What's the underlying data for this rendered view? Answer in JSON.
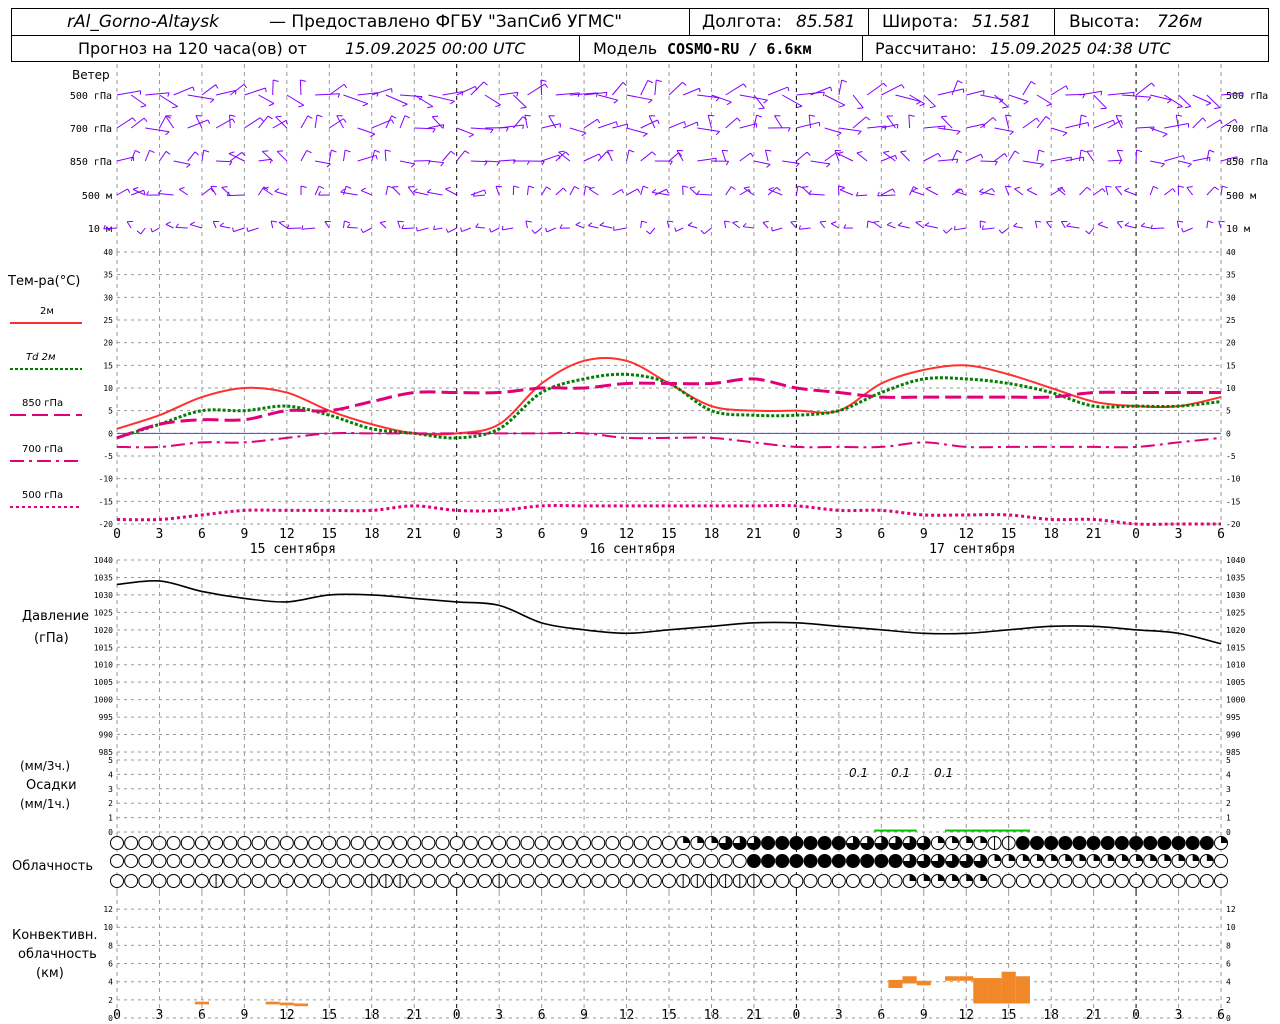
{
  "header": {
    "station": "rAl_Gorno-Altaysk",
    "provider": "— Предоставлено ФГБУ \"ЗапСиб УГМС\"",
    "lon_label": "Долгота:",
    "lon_value": "85.581",
    "lat_label": "Широта:",
    "lat_value": "51.581",
    "alt_label": "Высота:",
    "alt_value": "726м",
    "forecast_label": "Прогноз на 120 часа(ов) от",
    "forecast_time": "15.09.2025 00:00 UTC",
    "model_label": "Модель",
    "model_name": "COSMO-RU / 6.6км",
    "calc_label": "Рассчитано:",
    "calc_time": "15.09.2025 04:38 UTC"
  },
  "panels": {
    "wind": {
      "title": "Ветер",
      "levels": [
        "500 гПа",
        "700 гПа",
        "850 гПа",
        "500 м",
        "10 м"
      ]
    },
    "temp": {
      "title": "Тем-ра(°C)",
      "legend": [
        "2м",
        "Td  2м",
        "850 гПа",
        "700 гПа",
        "500 гПа"
      ]
    },
    "pressure": {
      "title_line1": "Давление",
      "title_line2": "(гПа)"
    },
    "precip": {
      "line1": "(мм/3ч.)",
      "line2": "Осадки",
      "line3": "(мм/1ч.)",
      "values": [
        "0.1",
        "0.1",
        "0.1"
      ]
    },
    "cloud": {
      "title": "Облачность"
    },
    "conv": {
      "line1": "Конвективн.",
      "line2": "облачность",
      "line3": "(км)"
    }
  },
  "axis": {
    "hour_ticks": [
      "0",
      "3",
      "6",
      "9",
      "12",
      "15",
      "18",
      "21",
      "0",
      "3",
      "6",
      "9",
      "12",
      "15",
      "18",
      "21",
      "0",
      "3",
      "6",
      "9",
      "12",
      "15",
      "18",
      "21",
      "0",
      "3",
      "6"
    ],
    "days": [
      "15 сентября",
      "16 сентября",
      "17 сентября"
    ]
  },
  "colors": {
    "t2m": "#ff3030",
    "td2m": "#008000",
    "t850": "#e0007a",
    "t700": "#e0007a",
    "t500": "#e0007a",
    "wind": "#8000ff",
    "precip": "#00c000",
    "conv": "#f0882a",
    "grid": "#9a9a9a"
  },
  "chart_data": [
    {
      "type": "line",
      "panel": "temperature",
      "ylim": [
        -20,
        40
      ],
      "yticks": [
        "40",
        "35",
        "30",
        "25",
        "20",
        "15",
        "10",
        "5",
        "0",
        "-5",
        "-10",
        "-15",
        "-20"
      ],
      "x_hours": [
        0,
        3,
        6,
        9,
        12,
        15,
        18,
        21,
        24,
        27,
        30,
        33,
        36,
        39,
        42,
        45,
        48,
        51,
        54,
        57,
        60,
        63,
        66,
        69,
        72,
        75,
        78
      ],
      "series": [
        {
          "name": "2м",
          "values": [
            1,
            4,
            8,
            10,
            9,
            5,
            2,
            0,
            0,
            2,
            11,
            16,
            16,
            11,
            6,
            5,
            5,
            5,
            11,
            14,
            15,
            13,
            10,
            7,
            6,
            6,
            8
          ]
        },
        {
          "name": "Td  2м",
          "values": [
            -1,
            2,
            5,
            5,
            6,
            4,
            1,
            0,
            -1,
            1,
            9,
            12,
            13,
            11,
            5,
            4,
            4,
            5,
            9,
            12,
            12,
            11,
            9,
            6,
            6,
            6,
            7
          ]
        },
        {
          "name": "850 гПа",
          "values": [
            -1,
            2,
            3,
            3,
            5,
            5,
            7,
            9,
            9,
            9,
            10,
            10,
            11,
            11,
            11,
            12,
            10,
            9,
            8,
            8,
            8,
            8,
            8,
            9,
            9,
            9,
            9
          ]
        },
        {
          "name": "700 гПа",
          "values": [
            -3,
            -3,
            -2,
            -2,
            -1,
            0,
            0,
            0,
            0,
            0,
            0,
            0,
            -1,
            -1,
            -1,
            -2,
            -3,
            -3,
            -3,
            -2,
            -3,
            -3,
            -3,
            -3,
            -3,
            -2,
            -1
          ]
        },
        {
          "name": "500 гПа",
          "values": [
            -19,
            -19,
            -18,
            -17,
            -17,
            -17,
            -17,
            -16,
            -17,
            -17,
            -16,
            -16,
            -16,
            -16,
            -16,
            -16,
            -16,
            -17,
            -17,
            -18,
            -18,
            -18,
            -19,
            -19,
            -20,
            -20,
            -20
          ]
        }
      ]
    },
    {
      "type": "line",
      "panel": "pressure",
      "ylim": [
        985,
        1040
      ],
      "yticks": [
        "1040",
        "1035",
        "1030",
        "1025",
        "1020",
        "1015",
        "1010",
        "1005",
        "1000",
        "995",
        "990",
        "985"
      ],
      "x_hours": [
        0,
        3,
        6,
        9,
        12,
        15,
        18,
        21,
        24,
        27,
        30,
        33,
        36,
        39,
        42,
        45,
        48,
        51,
        54,
        57,
        60,
        63,
        66,
        69,
        72,
        75,
        78
      ],
      "series": [
        {
          "name": "Давление",
          "values": [
            1033,
            1034,
            1031,
            1029,
            1028,
            1030,
            1030,
            1029,
            1028,
            1027,
            1022,
            1020,
            1019,
            1020,
            1021,
            1022,
            1022,
            1021,
            1020,
            1019,
            1019,
            1020,
            1021,
            1021,
            1020,
            1019,
            1016
          ]
        }
      ]
    },
    {
      "type": "bar",
      "panel": "precipitation",
      "ylim": [
        0,
        5
      ],
      "yticks": [
        "5",
        "4",
        "3",
        "2",
        "1",
        "0"
      ],
      "x_hours": [
        55,
        60,
        63
      ],
      "values": [
        0.1,
        0.1,
        0.1
      ]
    },
    {
      "type": "bar",
      "panel": "convective_cloud",
      "ylim": [
        0,
        13
      ],
      "yticks": [
        "12",
        "10",
        "8",
        "6",
        "4",
        "2",
        "0"
      ],
      "bars": [
        {
          "hour": 6,
          "base_km": 1.5,
          "top_km": 1.8
        },
        {
          "hour": 11,
          "base_km": 1.5,
          "top_km": 1.8
        },
        {
          "hour": 12,
          "base_km": 1.4,
          "top_km": 1.7
        },
        {
          "hour": 13,
          "base_km": 1.3,
          "top_km": 1.6
        },
        {
          "hour": 55,
          "base_km": 3.3,
          "top_km": 4.2
        },
        {
          "hour": 56,
          "base_km": 3.8,
          "top_km": 4.6
        },
        {
          "hour": 57,
          "base_km": 3.6,
          "top_km": 4.1
        },
        {
          "hour": 59,
          "base_km": 4.1,
          "top_km": 4.6
        },
        {
          "hour": 60,
          "base_km": 4.1,
          "top_km": 4.6
        },
        {
          "hour": 61,
          "base_km": 1.6,
          "top_km": 4.4
        },
        {
          "hour": 62,
          "base_km": 1.6,
          "top_km": 4.4
        },
        {
          "hour": 63,
          "base_km": 1.6,
          "top_km": 5.1
        },
        {
          "hour": 64,
          "base_km": 1.6,
          "top_km": 4.6
        }
      ]
    }
  ]
}
